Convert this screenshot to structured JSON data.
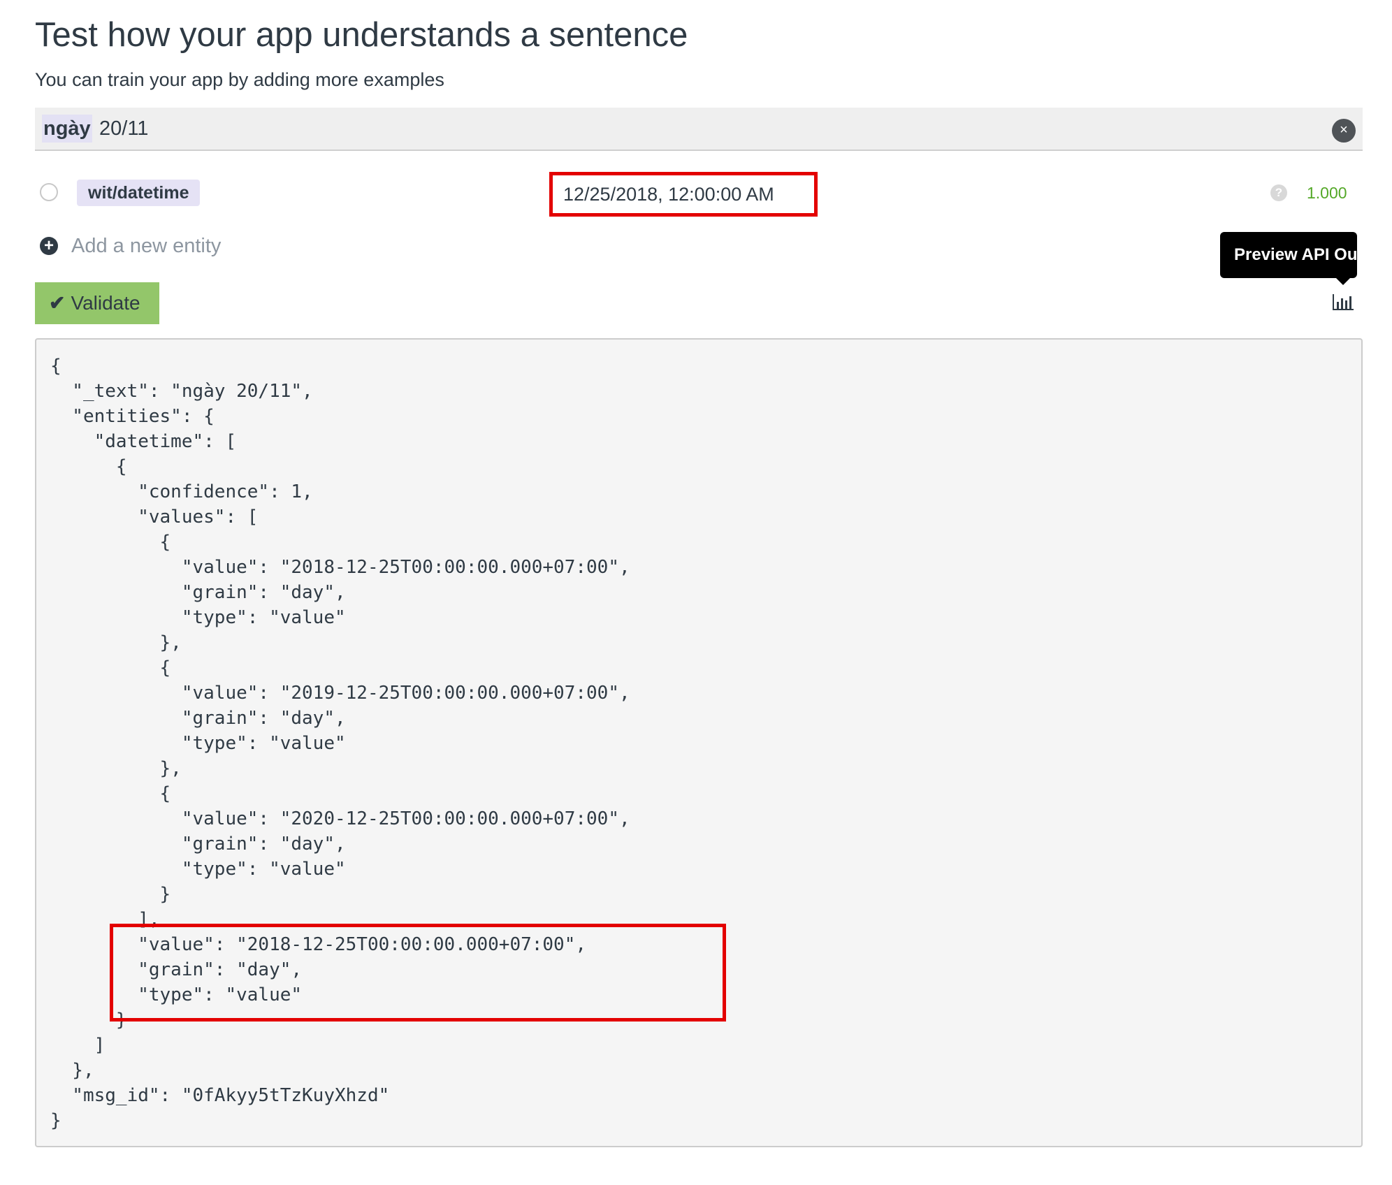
{
  "header": {
    "title": "Test how your app understands a sentence",
    "subtitle": "You can train your app by adding more examples"
  },
  "sentence": {
    "highlighted_token": "ngày",
    "rest": " 20/11",
    "clear_icon": "close-icon"
  },
  "entity": {
    "tag": "wit/datetime",
    "value": "12/25/2018, 12:00:00 AM",
    "help_icon": "question-icon",
    "confidence": "1.000"
  },
  "add_entity": {
    "label": "Add a new entity",
    "icon": "plus-circle-icon"
  },
  "validate": {
    "icon": "check-icon",
    "label": "Validate"
  },
  "tooltip": {
    "text": "Preview API Out",
    "icon": "bar-chart-icon"
  },
  "api_output": {
    "code": "{\n  \"_text\": \"ngày 20/11\",\n  \"entities\": {\n    \"datetime\": [\n      {\n        \"confidence\": 1,\n        \"values\": [\n          {\n            \"value\": \"2018-12-25T00:00:00.000+07:00\",\n            \"grain\": \"day\",\n            \"type\": \"value\"\n          },\n          {\n            \"value\": \"2019-12-25T00:00:00.000+07:00\",\n            \"grain\": \"day\",\n            \"type\": \"value\"\n          },\n          {\n            \"value\": \"2020-12-25T00:00:00.000+07:00\",\n            \"grain\": \"day\",\n            \"type\": \"value\"\n          }\n        ],\n        \"value\": \"2018-12-25T00:00:00.000+07:00\",\n        \"grain\": \"day\",\n        \"type\": \"value\"\n      }\n    ]\n  },\n  \"msg_id\": \"0fAkyy5tTzKuyXhzd\"\n}"
  },
  "colors": {
    "annotation_red": "#e30000",
    "validate_green": "#93c66a",
    "confidence_green": "#54a828",
    "entity_tag_bg": "#e5e2f5"
  }
}
